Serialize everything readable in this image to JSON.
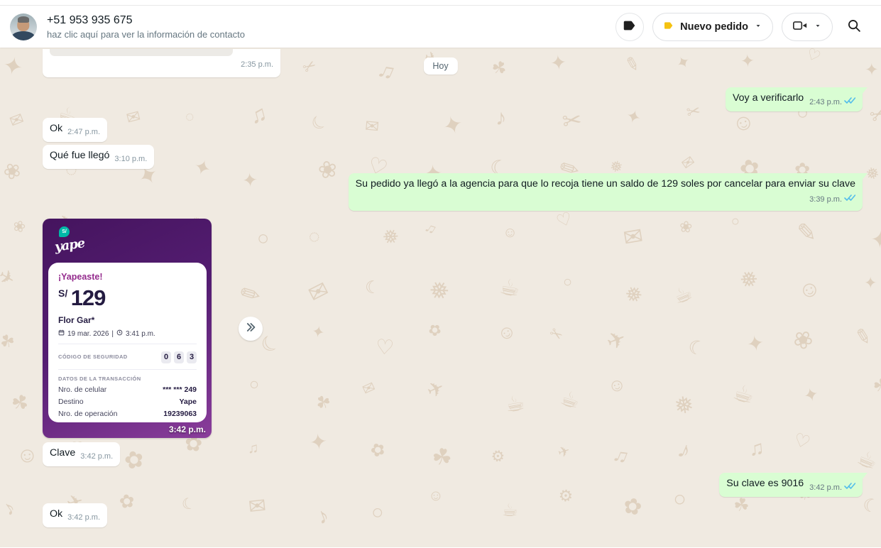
{
  "header": {
    "contact_name": "+51 953 935 675",
    "contact_subtitle": "haz clic aquí para ver la información de contacto",
    "order_button_label": "Nuevo pedido"
  },
  "icons": {
    "black_label": "label-icon",
    "yellow_label": "tag-icon",
    "video": "video-camera-icon",
    "caret": "chevron-down-icon",
    "search": "search-icon",
    "forward": "forward-icon",
    "checks": "double-check-icon"
  },
  "colors": {
    "outgoing_bubble": "#d9fdd3",
    "incoming_bubble": "#ffffff",
    "check_blue": "#53bdeb",
    "accent_yellow": "#f5c211",
    "yape_purple": "#45145e",
    "yape_teal": "#00b9a7",
    "chat_background": "#f0eae1"
  },
  "chat": {
    "date_divider": "Hoy",
    "messages": [
      {
        "side": "left",
        "type": "partial",
        "time": "2:35 p.m."
      },
      {
        "side": "right",
        "type": "text",
        "text": "Voy a verificarlo",
        "time": "2:43 p.m."
      },
      {
        "side": "left",
        "type": "text",
        "text": "Ok",
        "time": "2:47 p.m."
      },
      {
        "side": "left",
        "type": "text",
        "text": "Qué fue llegó",
        "time": "3:10 p.m."
      },
      {
        "side": "right",
        "type": "text",
        "text": "Su pedido ya llegó a la agencia para que lo recoja tiene un saldo de 129 soles por cancelar para enviar su clave",
        "time": "3:39 p.m."
      },
      {
        "side": "left",
        "type": "image",
        "time": "3:42 p.m."
      },
      {
        "side": "left",
        "type": "text",
        "text": "Clave",
        "time": "3:42 p.m."
      },
      {
        "side": "right",
        "type": "text",
        "text": "Su clave es 9016",
        "time": "3:42 p.m."
      },
      {
        "side": "left",
        "type": "text",
        "text": "Ok",
        "time": "3:42 p.m."
      }
    ]
  },
  "receipt": {
    "brand": "yape",
    "logo_symbol": "S/",
    "title": "¡Yapeaste!",
    "currency": "S/",
    "amount": "129",
    "payer": "Flor Gar*",
    "date": "19 mar. 2026",
    "time": "3:41 p.m.",
    "security_code_label": "CÓDIGO DE SEGURIDAD",
    "security_code": [
      "0",
      "6",
      "3"
    ],
    "transaction_label": "DATOS DE LA TRANSACCIÓN",
    "rows": [
      {
        "label": "Nro. de celular",
        "value": "*** *** 249"
      },
      {
        "label": "Destino",
        "value": "Yape"
      },
      {
        "label": "Nro. de operación",
        "value": "19239063"
      }
    ]
  }
}
